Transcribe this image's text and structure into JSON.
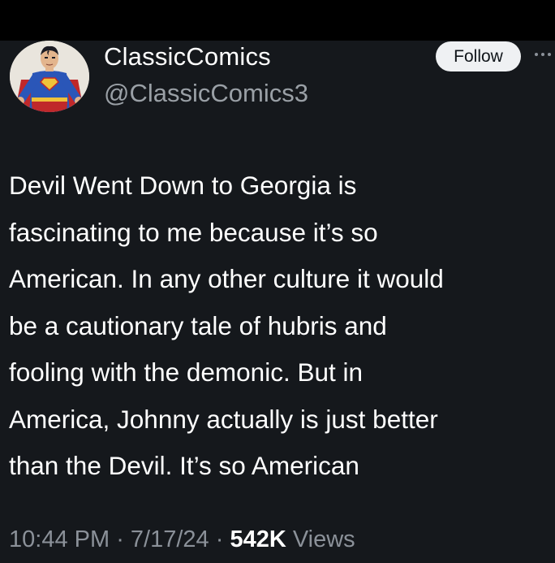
{
  "tweet": {
    "display_name": "ClassicComics",
    "handle": "@ClassicComics3",
    "follow_label": "Follow",
    "text_lines": [
      "Devil Went Down to Georgia is",
      "fascinating to me because it’s so",
      "American. In any other culture it would",
      "be a cautionary tale of hubris and",
      "fooling with the demonic. But in",
      "America, Johnny actually is just better",
      "than the Devil. It’s so American"
    ],
    "time": "10:44 PM",
    "separator": " · ",
    "date": "7/17/24",
    "views_count": "542K",
    "views_label": " Views"
  },
  "icons": {
    "avatar": "superman-avatar",
    "more": "more-horizontal-icon"
  },
  "colors": {
    "background": "#15181c",
    "top_bar": "#000000",
    "text_primary": "#ffffff",
    "text_secondary": "#9aa0a6",
    "follow_button_bg": "#eff1f3"
  }
}
